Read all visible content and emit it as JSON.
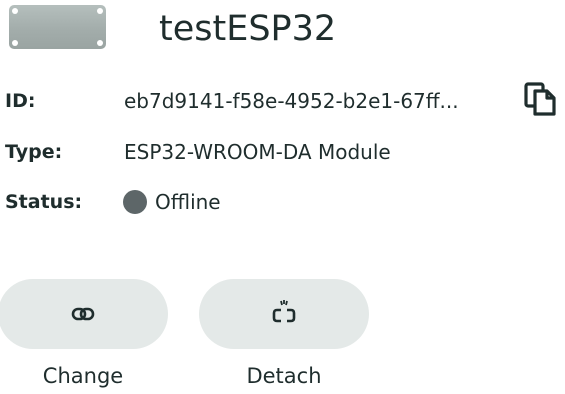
{
  "device": {
    "name": "testESP32",
    "image_icon": "esp32-board-image"
  },
  "details": {
    "id_label": "ID:",
    "id_value": "eb7d9141-f58e-4952-b2e1-67ff...",
    "type_label": "Type:",
    "type_value": "ESP32-WROOM-DA Module",
    "status_label": "Status:",
    "status_value": "Offline",
    "status_color": "#5d6668"
  },
  "actions": {
    "copy_icon": "copy-icon",
    "change_label": "Change",
    "change_icon": "link-icon",
    "detach_label": "Detach",
    "detach_icon": "unlink-icon"
  },
  "colors": {
    "text": "#1f2d2d",
    "button_bg": "#e4e9e8"
  }
}
